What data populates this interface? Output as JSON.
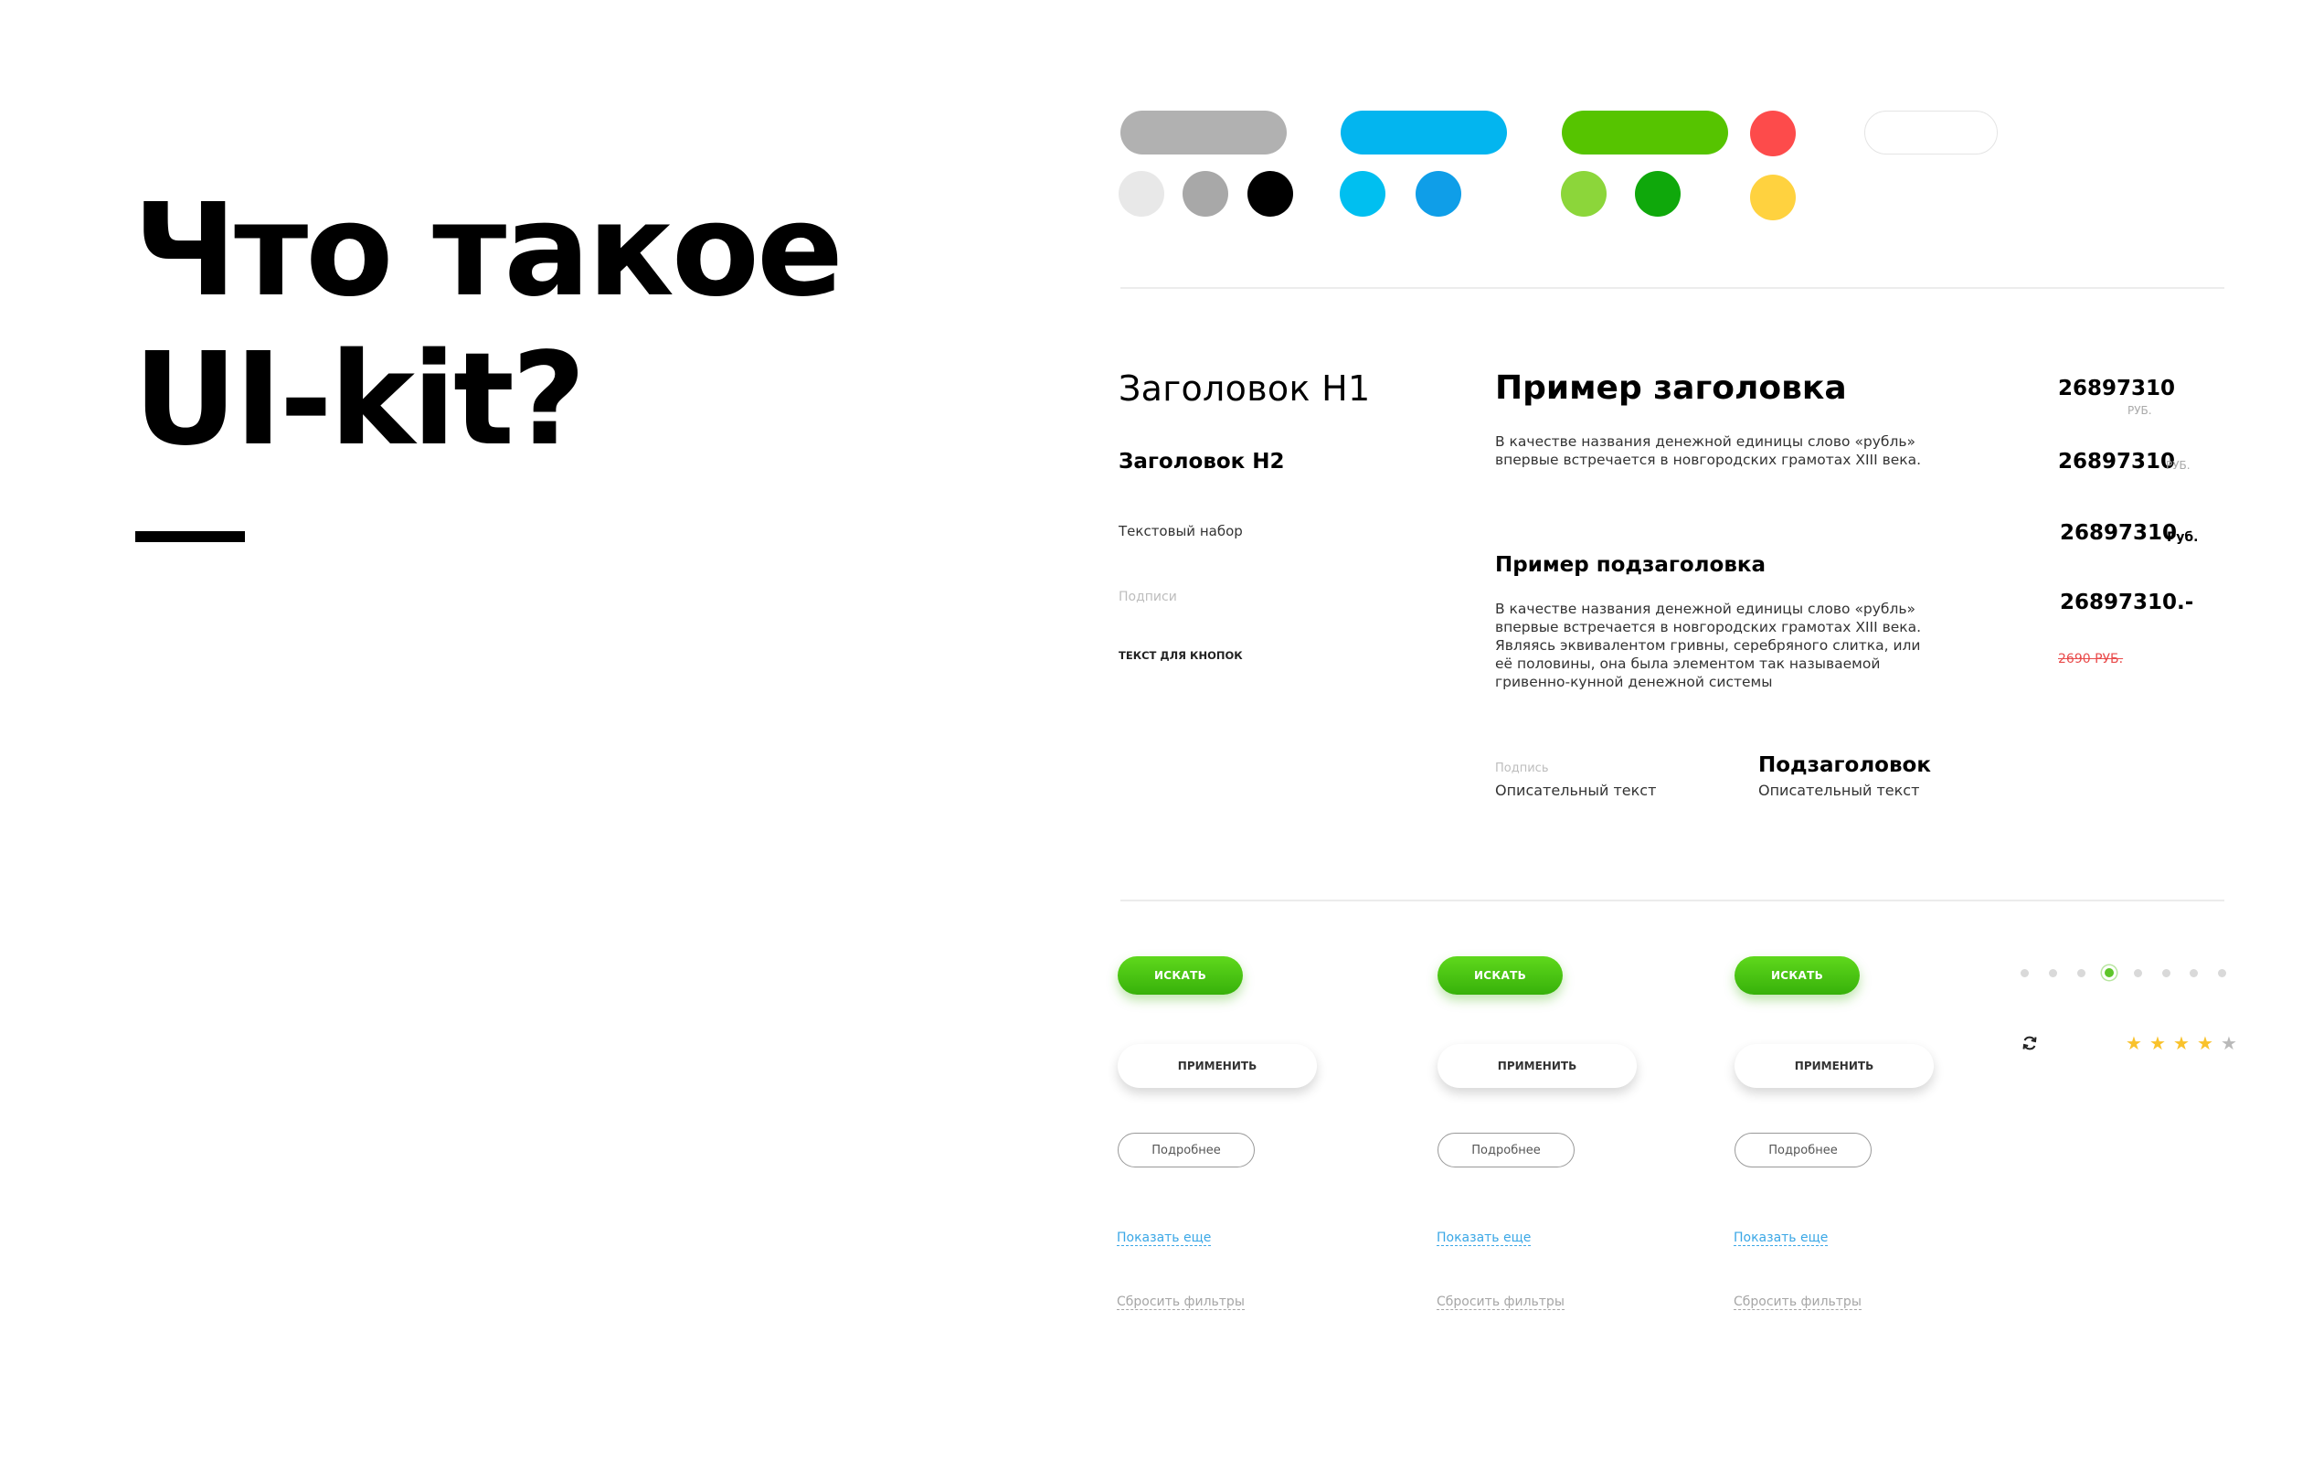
{
  "hero": {
    "line1": "Что такое",
    "line2": "UI-kit?"
  },
  "palette": {
    "pills": [
      {
        "name": "gray",
        "color": "#b1b1b1"
      },
      {
        "name": "blue",
        "color": "#03b5ef"
      },
      {
        "name": "green",
        "color": "#56c400"
      }
    ],
    "dots": {
      "gray_group": [
        "#e8e8e8",
        "#a8a8a8",
        "#000000"
      ],
      "blue_group": [
        "#00bff0",
        "#0f9ee8"
      ],
      "green_group": [
        "#8cd63a",
        "#0fa80b"
      ],
      "red": "#fd4b4b",
      "yellow": "#ffd23f"
    },
    "outline_pill_border": "#e4e4e4"
  },
  "typography": {
    "h1": "Заголовок H1",
    "h2": "Заголовок H2",
    "body": "Текстовый набор",
    "caption": "Подписи",
    "button_text": "ТЕКСТ ДЛЯ КНОПОК",
    "sample_heading": "Пример заголовка",
    "sample_heading_text": "В качестве названия денежной единицы слово «рубль» впервые встречается в новгородских грамотах XIII века.",
    "sample_subheading": "Пример подзаголовка",
    "sample_subheading_text": "В качестве названия денежной единицы слово «рубль» впервые встречается в новгородских грамотах XIII века. Являясь эквивалентом гривны, серебряного слитка, или её половины, она была элементом так называемой гривенно-кунной денежной системы",
    "label_caption": "Подпись",
    "label_desc": "Описательный текст",
    "subhead": "Подзаголовок",
    "subhead_desc": "Описательный текст"
  },
  "prices": [
    {
      "value": "26897310",
      "unit": "РУБ."
    },
    {
      "value": "26897310",
      "unit": "РУБ."
    },
    {
      "value": "26897310",
      "unit": "Руб."
    },
    {
      "value": "26897310.-"
    },
    {
      "old": "2690 РУБ."
    }
  ],
  "buttons": {
    "search": "ИСКАТЬ",
    "apply": "ПРИМЕНИТЬ",
    "more": "Подробнее",
    "show_more": "Показать еще",
    "reset": "Сбросить фильтры"
  },
  "pagination": {
    "count": 8,
    "active_index": 3
  },
  "rating": {
    "value": 4,
    "max": 5,
    "filled_color": "#f9c22b",
    "empty_color": "#b9b9b9"
  },
  "icons": {
    "refresh": "refresh-icon"
  }
}
